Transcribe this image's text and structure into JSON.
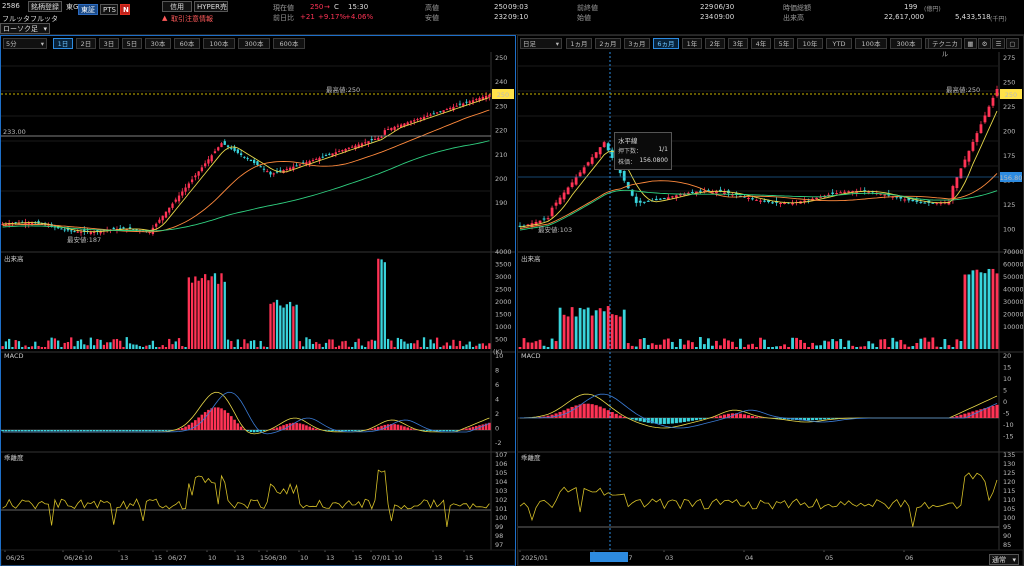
{
  "header": {
    "code": "2586",
    "register_label": "銘柄登録",
    "exchange_short": "東G",
    "company_name": "フルッタフルッタ",
    "tab_exchange": "東証",
    "tab_pts": "PTS",
    "n_badge": "N",
    "credit_label": "信用",
    "hyper_label": "HYPER売",
    "warning_label": "取引注意情報",
    "fields": {
      "current_label": "現在値",
      "current_value": "250",
      "current_flag": "C",
      "current_time": "15:30",
      "prev_diff_label": "前日比",
      "prev_diff_value": "+21",
      "prev_diff_pct1": "+9.17%",
      "prev_diff_pct2": "+4.06%",
      "high_label": "高値",
      "high_value": "250",
      "high_time": "09:03",
      "low_label": "安値",
      "low_value": "232",
      "low_time": "09:10",
      "prev_close_label": "前終値",
      "prev_close_value": "229",
      "prev_close_date": "06/30",
      "open_label": "始値",
      "open_value": "234",
      "open_time": "09:00",
      "market_cap_label": "時価総額",
      "market_cap_value": "199",
      "market_cap_unit": "(億円)",
      "volume_label": "出来高",
      "volume_value": "22,617,000",
      "turnover_value": "5,433,518",
      "turnover_unit": "(千円)"
    }
  },
  "left": {
    "footer_select": "ローソク足",
    "interval_select": "5分",
    "ranges": [
      "1日",
      "2日",
      "3日",
      "5日",
      "30本",
      "60本",
      "100本",
      "300本",
      "600本"
    ],
    "active_range": "1日",
    "price_label_box": "250",
    "ref_line_label": "233.00",
    "high_annotation": "最高値:250",
    "low_annotation": "最安値:187",
    "y_ticks": [
      "250",
      "240",
      "230",
      "220",
      "210",
      "200",
      "190"
    ],
    "volume_title": "出来高",
    "volume_ticks": [
      "4000",
      "3500",
      "3000",
      "2500",
      "2000",
      "1500",
      "1000",
      "500"
    ],
    "volume_unit": "(K)",
    "macd_title": "MACD",
    "macd_ticks": [
      "10",
      "8",
      "6",
      "4",
      "2",
      "0",
      "-2"
    ],
    "psy_title": "乖離度",
    "psy_ticks": [
      "107",
      "106",
      "105",
      "104",
      "103",
      "102",
      "101",
      "100",
      "99",
      "98",
      "97"
    ],
    "x_ticks": [
      "06/25",
      "06/26",
      "10",
      "13",
      "15",
      "06/27",
      "10",
      "13",
      "15",
      "06/30",
      "10",
      "13",
      "15",
      "07/01",
      "10",
      "13",
      "15"
    ]
  },
  "right": {
    "interval_select": "日足",
    "ranges": [
      "1ヵ月",
      "2ヵ月",
      "3ヵ月",
      "6ヵ月",
      "1年",
      "2年",
      "3年",
      "4年",
      "5年",
      "10年",
      "YTD",
      "100本",
      "300本",
      "600本"
    ],
    "active_range": "6ヵ月",
    "technical_button": "テクニカル",
    "price_label_box": "250",
    "crosshair_label": "156.80",
    "high_annotation": "最高値:250",
    "low_annotation": "最安値:103",
    "y_ticks": [
      "275",
      "250",
      "225",
      "200",
      "175",
      "150",
      "125",
      "100"
    ],
    "tooltip": {
      "title": "水平線",
      "row1_label": "押下数：",
      "row1_value": "1/1",
      "row2_label": "株価：",
      "row2_value": "156.0800"
    },
    "volume_title": "出来高",
    "volume_ticks": [
      "70000",
      "60000",
      "50000",
      "40000",
      "30000",
      "20000",
      "10000"
    ],
    "macd_title": "MACD",
    "macd_ticks": [
      "20",
      "15",
      "10",
      "5",
      "0",
      "-5",
      "-10",
      "-15"
    ],
    "psy_title": "乖離度",
    "psy_ticks": [
      "135",
      "130",
      "125",
      "120",
      "115",
      "110",
      "105",
      "100",
      "95",
      "90",
      "85"
    ],
    "x_ticks": [
      "2025/01",
      "2025/02/07",
      "03",
      "04",
      "05",
      "06"
    ],
    "footer_select": "通常"
  },
  "colors": {
    "up": "#ff3355",
    "down": "#39d4dc",
    "ma_short": "#e8d84a",
    "ma_mid": "#ff8a3d",
    "ma_long": "#30d080",
    "selection": "#1e6fc8"
  }
}
